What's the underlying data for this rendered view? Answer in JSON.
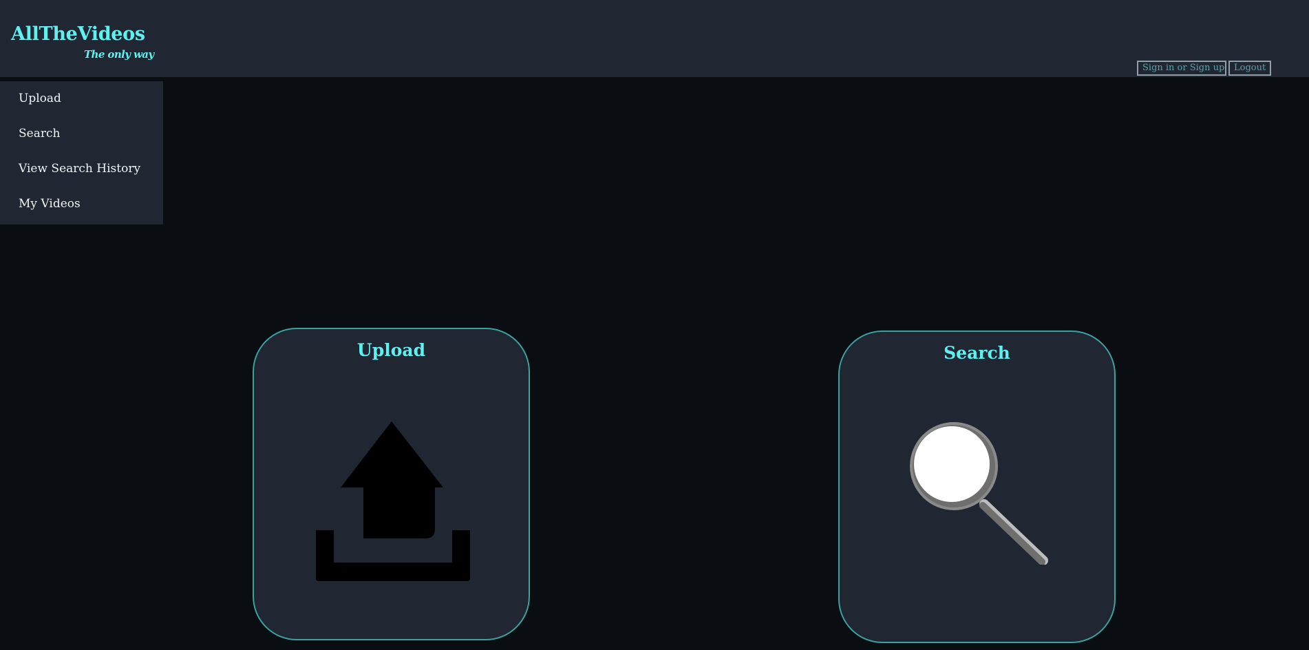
{
  "header": {
    "app_title": "AllTheVideos",
    "tagline": "The only way",
    "signin_label": "Sign in or Sign up",
    "logout_label": "Logout"
  },
  "sidebar": {
    "items": [
      {
        "label": "Upload"
      },
      {
        "label": "Search"
      },
      {
        "label": "View Search History"
      },
      {
        "label": "My Videos"
      }
    ]
  },
  "cards": [
    {
      "title": "Upload",
      "icon": "upload-icon"
    },
    {
      "title": "Search",
      "icon": "magnifying-glass-icon"
    }
  ],
  "colors": {
    "page_background": "#0a0d11",
    "panel_background": "#202733",
    "accent_cyan": "#5ff0f0",
    "card_border": "#3aa39f",
    "auth_text": "#4fa8aa"
  }
}
